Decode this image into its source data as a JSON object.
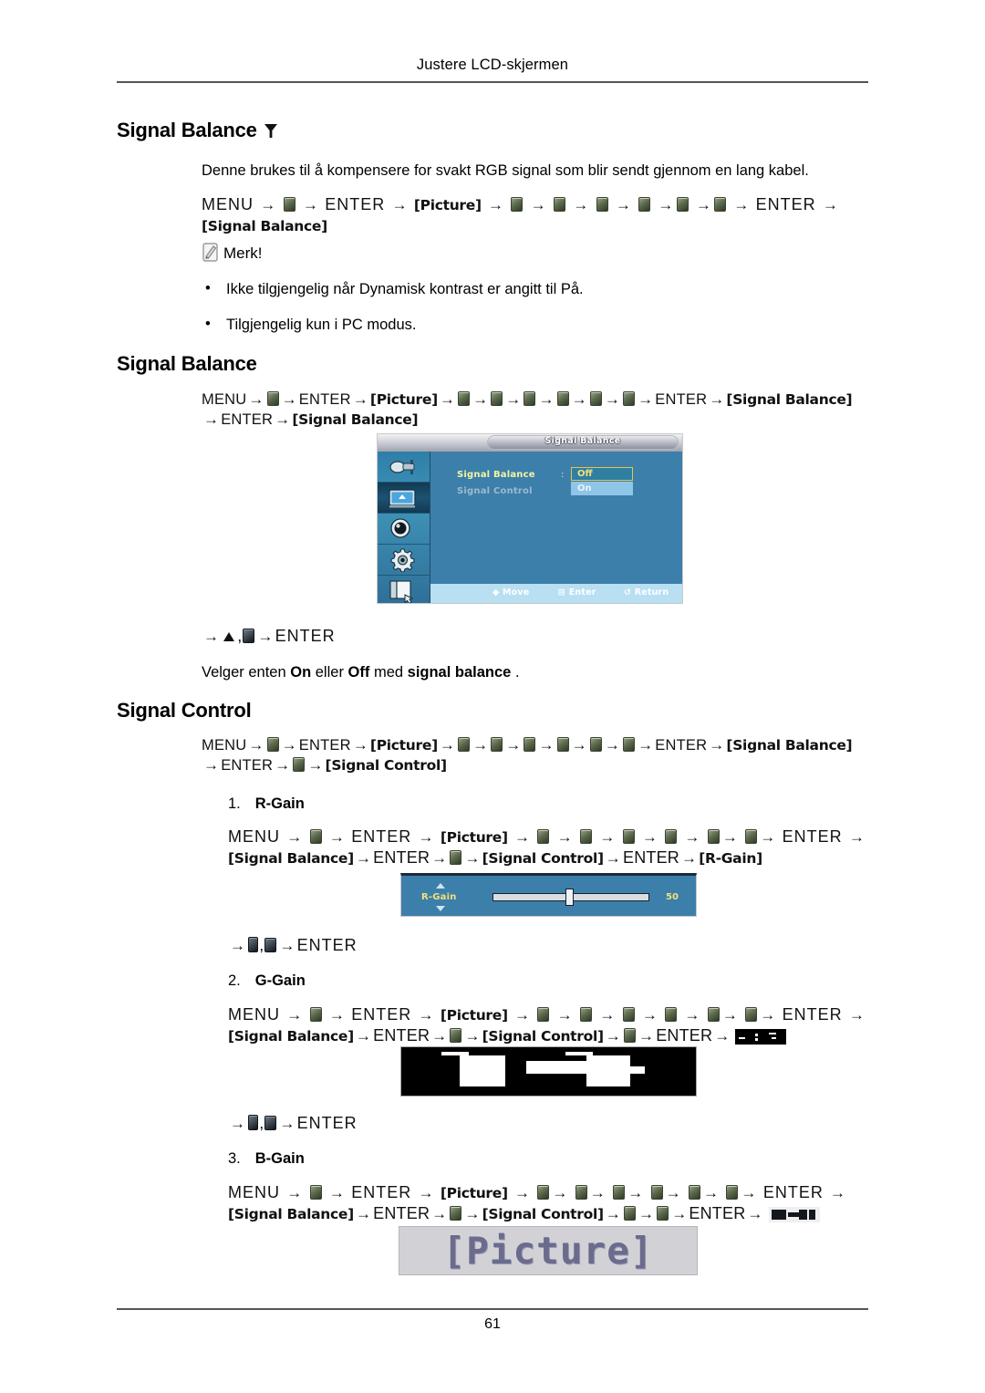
{
  "page": {
    "running_head": "Justere LCD-skjermen",
    "page_number": "61"
  },
  "section1": {
    "heading": "Signal Balance",
    "heading_icon": "funnel-icon",
    "description": "Denne brukes til å kompensere for svakt RGB signal som blir sendt gjennom en lang kabel.",
    "path": {
      "menu": "MENU",
      "enter1": "ENTER",
      "picture": "[Picture]",
      "enter2": "ENTER",
      "signal_balance": "[Signal Balance]"
    },
    "note": {
      "label": "Merk!",
      "icon": "note-pencil-icon",
      "bullets": [
        "Ikke tilgjengelig når Dynamisk kontrast er angitt til På.",
        "Tilgjengelig kun i PC modus."
      ]
    }
  },
  "section2": {
    "heading": "Signal Balance",
    "path": {
      "menu": "MENU",
      "enter1": "ENTER",
      "picture": "[Picture]",
      "enter2": "ENTER",
      "signal_balance_1": "[Signal Balance]",
      "enter3": "ENTER",
      "signal_balance_2": "[Signal Balance]"
    },
    "osd": {
      "title": "Signal Balance",
      "menu_items": [
        {
          "label": "Signal Balance",
          "selected": true
        },
        {
          "label": "Signal Control",
          "selected": false
        }
      ],
      "colon": ":",
      "options": [
        {
          "label": "Off",
          "highlighted": true
        },
        {
          "label": "On",
          "highlighted": false
        }
      ],
      "footer": [
        {
          "icon": "move-icon",
          "label": "Move"
        },
        {
          "icon": "enter-icon",
          "label": "Enter"
        },
        {
          "icon": "return-icon",
          "label": "Return"
        }
      ],
      "sidebar_icons": [
        "input-source-icon",
        "picture-icon",
        "sound-icon",
        "setup-gear-icon",
        "multi-control-icon"
      ],
      "colors": {
        "panel_blue": "#3c7fab",
        "highlight_yellow": "#f3e07a",
        "option_on_blue": "#8fc6e8",
        "footer_blue": "#b8dff2"
      }
    },
    "keys_line": {
      "enter": "ENTER"
    },
    "description": {
      "pre": "Velger enten ",
      "on": "On",
      "mid": " eller ",
      "off": "Off",
      "mid2": " med ",
      "term": "signal balance",
      "post": " ."
    }
  },
  "section3": {
    "heading": "Signal Control",
    "path": {
      "menu": "MENU",
      "enter1": "ENTER",
      "picture": "[Picture]",
      "enter2": "ENTER",
      "signal_balance": "[Signal Balance]",
      "enter3": "ENTER",
      "signal_control": "[Signal Control]"
    },
    "items": [
      {
        "number": "1.",
        "name": "R-Gain",
        "path": {
          "menu": "MENU",
          "enter1": "ENTER",
          "picture": "[Picture]",
          "enter2": "ENTER",
          "signal_balance": "[Signal Balance]",
          "enter3": "ENTER",
          "signal_control": "[Signal Control]",
          "enter4": "ENTER",
          "target": "[R-Gain]"
        },
        "widget": {
          "type": "slider",
          "label": "R-Gain",
          "value": "50",
          "thumb_percent": 50
        },
        "keys_line": {
          "enter": "ENTER"
        }
      },
      {
        "number": "2.",
        "name": "G-Gain",
        "path": {
          "menu": "MENU",
          "enter1": "ENTER",
          "picture": "[Picture]",
          "enter2": "ENTER",
          "signal_balance": "[Signal Balance]",
          "enter3": "ENTER",
          "signal_control": "[Signal Control]",
          "enter4": "ENTER",
          "target": ""
        },
        "widget": {
          "type": "corrupted-slider",
          "label": "",
          "value": ""
        },
        "keys_line": {
          "enter": "ENTER"
        }
      },
      {
        "number": "3.",
        "name": "B-Gain",
        "path": {
          "menu": "MENU",
          "enter1": "ENTER",
          "picture": "[Picture]",
          "enter2": "ENTER",
          "signal_balance": "[Signal Balance]",
          "enter3": "ENTER",
          "signal_control": "[Signal Control]",
          "enter4": "ENTER",
          "target": ""
        },
        "widget": {
          "type": "pixel-graphic",
          "text": "[Picture]"
        }
      }
    ]
  },
  "symbols": {
    "arrow": "→",
    "comma": ",",
    "bullet": "•"
  }
}
